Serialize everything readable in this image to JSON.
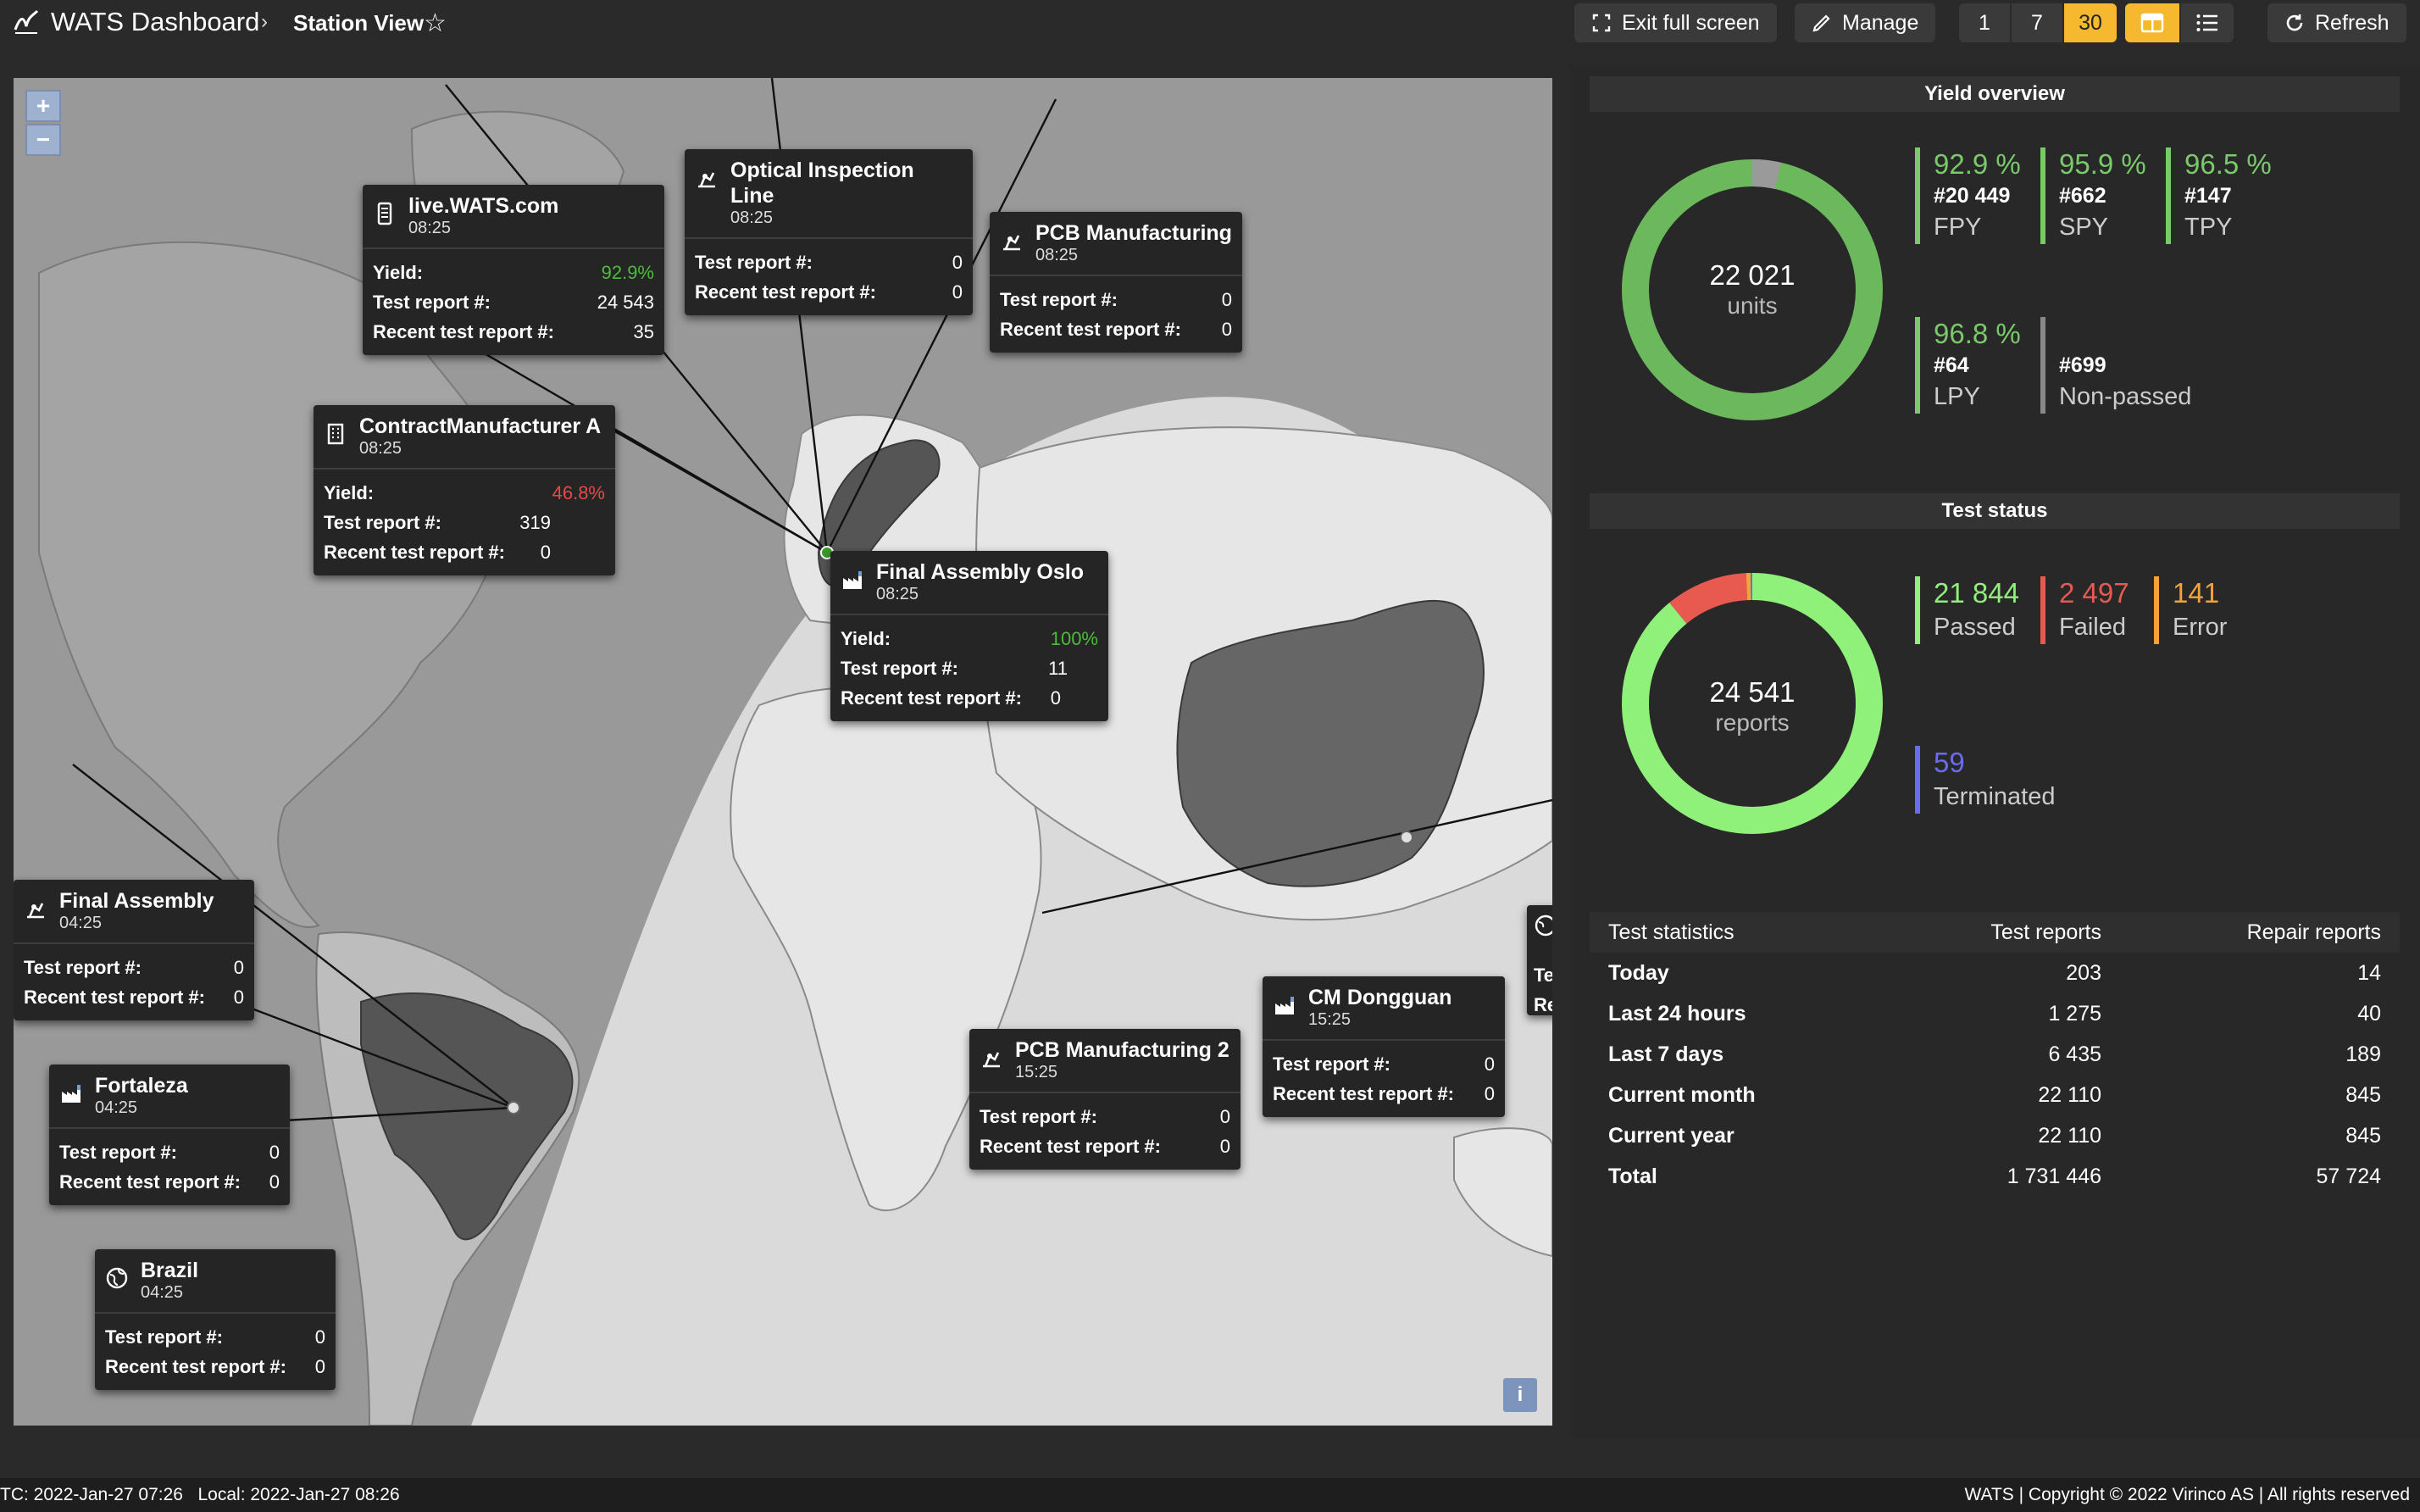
{
  "header": {
    "app_title": "WATS Dashboard",
    "breadcrumb_sep": "›",
    "page_title": "Station View",
    "favorite_icon": "☆",
    "exit_fullscreen_label": "Exit full screen",
    "manage_label": "Manage",
    "periods": [
      "1",
      "7",
      "30"
    ],
    "active_period": "30",
    "refresh_label": "Refresh",
    "accent_color": "#f5b82e"
  },
  "map": {
    "zoom_in": "+",
    "zoom_out": "−",
    "info": "i",
    "stations": [
      {
        "name": "live.WATS.com",
        "time": "08:25",
        "icon": "server-icon",
        "yield_label": "Yield:",
        "yield": "92.9%",
        "reports_label": "Test report #:",
        "reports": "24 543",
        "recent_label": "Recent test report #:",
        "recent": "35"
      },
      {
        "name": "Optical Inspection Line",
        "time": "08:25",
        "icon": "inspection-icon",
        "reports_label": "Test report #:",
        "reports": "0",
        "recent_label": "Recent test report #:",
        "recent": "0"
      },
      {
        "name": "PCB Manufacturing",
        "time": "08:25",
        "icon": "inspection-icon",
        "reports_label": "Test report #:",
        "reports": "0",
        "recent_label": "Recent test report #:",
        "recent": "0"
      },
      {
        "name": "ContractManufacturer A",
        "time": "08:25",
        "icon": "building-icon",
        "yield_label": "Yield:",
        "yield": "46.8%",
        "reports_label": "Test report #:",
        "reports": "319",
        "recent_label": "Recent test report #:",
        "recent": "0"
      },
      {
        "name": "Final Assembly Oslo",
        "time": "08:25",
        "icon": "factory-icon",
        "yield_label": "Yield:",
        "yield": "100%",
        "reports_label": "Test report #:",
        "reports": "11",
        "recent_label": "Recent test report #:",
        "recent": "0"
      },
      {
        "name": "Final Assembly",
        "time": "04:25",
        "icon": "inspection-icon",
        "reports_label": "Test report #:",
        "reports": "0",
        "recent_label": "Recent test report #:",
        "recent": "0"
      },
      {
        "name": "Fortaleza",
        "time": "04:25",
        "icon": "factory-icon",
        "reports_label": "Test report #:",
        "reports": "0",
        "recent_label": "Recent test report #:",
        "recent": "0"
      },
      {
        "name": "Brazil",
        "time": "04:25",
        "icon": "globe-icon",
        "reports_label": "Test report #:",
        "reports": "0",
        "recent_label": "Recent test report #:",
        "recent": "0"
      },
      {
        "name": "PCB Manufacturing 2",
        "time": "15:25",
        "icon": "inspection-icon",
        "reports_label": "Test report #:",
        "reports": "0",
        "recent_label": "Recent test report #:",
        "recent": "0"
      },
      {
        "name": "CM Dongguan",
        "time": "15:25",
        "icon": "factory-icon",
        "reports_label": "Test report #:",
        "reports": "0",
        "recent_label": "Recent test report #:",
        "recent": "0"
      }
    ],
    "clipped_card_lines": [
      "Te",
      "Re"
    ]
  },
  "yield_overview": {
    "title": "Yield overview",
    "total": "22 021",
    "total_unit": "units",
    "fpy_fraction": 0.929,
    "stats": [
      {
        "pct": "92.9 %",
        "count": "#20 449",
        "label": "FPY",
        "color": "#7ac96a"
      },
      {
        "pct": "95.9 %",
        "count": "#662",
        "label": "SPY",
        "color": "#7ac96a"
      },
      {
        "pct": "96.5 %",
        "count": "#147",
        "label": "TPY",
        "color": "#7ac96a"
      },
      {
        "pct": "96.8 %",
        "count": "#64",
        "label": "LPY",
        "color": "#7ac96a"
      },
      {
        "pct": "",
        "count": "#699",
        "label": "Non-passed",
        "color": "#888888"
      }
    ]
  },
  "test_status": {
    "title": "Test status",
    "total": "24 541",
    "total_unit": "reports",
    "stats": [
      {
        "value": "21 844",
        "label": "Passed",
        "color": "#8ff07a"
      },
      {
        "value": "2 497",
        "label": "Failed",
        "color": "#e85a50"
      },
      {
        "value": "141",
        "label": "Error",
        "color": "#f2a33a"
      },
      {
        "value": "59",
        "label": "Terminated",
        "color": "#6b6bf0"
      }
    ]
  },
  "test_statistics": {
    "headers": [
      "Test statistics",
      "Test reports",
      "Repair reports"
    ],
    "rows": [
      [
        "Today",
        "203",
        "14"
      ],
      [
        "Last 24 hours",
        "1 275",
        "40"
      ],
      [
        "Last 7 days",
        "6 435",
        "189"
      ],
      [
        "Current month",
        "22 110",
        "845"
      ],
      [
        "Current year",
        "22 110",
        "845"
      ],
      [
        "Total",
        "1 731 446",
        "57 724"
      ]
    ]
  },
  "footer": {
    "utc": "TC: 2022-Jan-27 07:26",
    "local": "Local: 2022-Jan-27 08:26",
    "copyright": "WATS | Copyright © 2022 Virinco AS | All rights reserved"
  }
}
